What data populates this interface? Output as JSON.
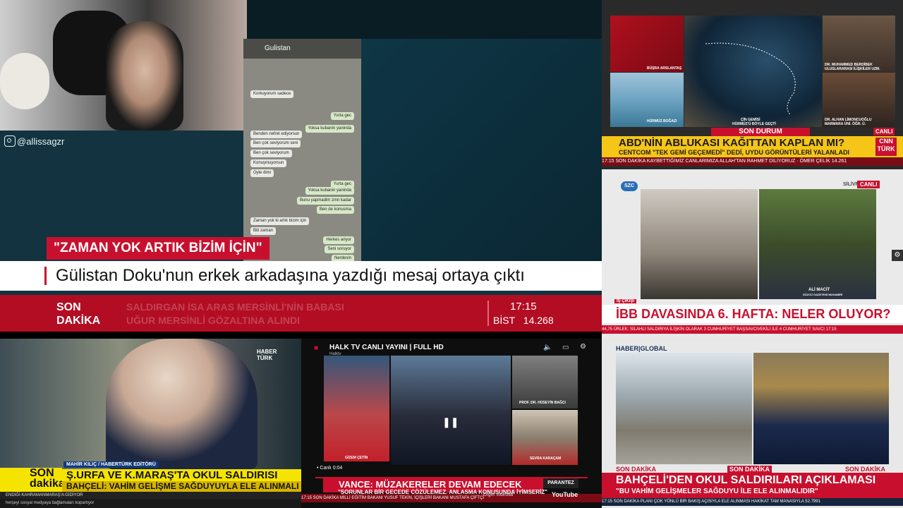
{
  "main": {
    "handle": "@allissagzr",
    "chat_name": "Gulistan",
    "chat_bubbles": [
      {
        "text": "Korkuyorum sadece",
        "dir": "in"
      },
      {
        "text": "Yurta gec",
        "dir": "out"
      },
      {
        "text": "Yoksa kubanin yaninda",
        "dir": "out"
      },
      {
        "text": "Benden nefret ediyorsun",
        "dir": "in"
      },
      {
        "text": "Ben çok seviyorum seni",
        "dir": "in"
      },
      {
        "text": "Ben çok seviyorum",
        "dir": "in"
      },
      {
        "text": "Konuşmuyorsun",
        "dir": "in"
      },
      {
        "text": "Oyle dimi",
        "dir": "in"
      },
      {
        "text": "Yurta gec",
        "dir": "out"
      },
      {
        "text": "Yoksa kubanin yaninda",
        "dir": "out"
      },
      {
        "text": "Bunu yapmadim zmn kadar",
        "dir": "out"
      },
      {
        "text": "Ben de konusma",
        "dir": "out"
      },
      {
        "text": "Zaman yok ki artık bizim için",
        "dir": "in"
      },
      {
        "text": "Biti zaman",
        "dir": "in"
      },
      {
        "text": "Herkes ariyor",
        "dir": "out"
      },
      {
        "text": "Seni soruyor",
        "dir": "out"
      },
      {
        "text": "Nerdesin",
        "dir": "out"
      }
    ],
    "quote": "\"ZAMAN YOK ARTIK BİZİM İÇİN\"",
    "headline": "Gülistan Doku'nun erkek arkadaşına yazdığı mesaj ortaya çıktı",
    "ticker": {
      "son_line1": "SON",
      "son_line2": "DAKİKA",
      "news_line1": "SALDIRGAN İSA ARAS MERSİNLİ'NİN BABASI",
      "news_line2": "UĞUR MERSİNLİ GÖZALTINA ALINDI",
      "time": "17:15",
      "bist_label": "BİST",
      "bist_value": "14.268"
    }
  },
  "cnn": {
    "anchor": "BÜŞRA ARSLANTAŞ",
    "strait": "HÜRMÜZ BOĞAZI",
    "map_caption1": "ÇİN GEMİSİ",
    "map_caption2": "HÜRMÜZ'Ü BÖYLE GEÇTİ",
    "guest1_name": "DR. MUHAMMED BERDİBEK",
    "guest1_title": "ULUSLARARASI İLİŞKİLER UZM.",
    "guest2_name": "DR. ALHAN LİMONCUOĞLU",
    "guest2_title": "MARMARA ÜNİ. ÖĞR. Ü.",
    "son_durum": "SON DURUM",
    "canli": "CANLI",
    "headline": "ABD'NİN ABLUKASI KAĞITTAN KAPLAN MI?",
    "subline": "CENTCOM \"TEK GEMİ GEÇEMEDİ\" DEDİ, UYDU GÖRÜNTÜLERİ YALANLADI",
    "logo1": "CNN",
    "logo2": "TÜRK",
    "ticker": "17:15  SON DAKİKA  KAYBETTİĞİMİZ CANLARIMIZA ALLAH'TAN RAHMET DİLİYORUZ · ÖMER ÇELİK  14.261"
  },
  "szc": {
    "logo": "SZC",
    "location": "SİLİVRİ",
    "canli": "CANLI",
    "reporter_name": "ALİ MACİT",
    "reporter_title": "SÖZCÜ GAZETESİ MUHABİRİ",
    "tag": "İŞ ÇIKIŞI",
    "headline": "İBB DAVASINDA 6. HAFTA: NELER OLUYOR?",
    "ticker": "44,75  ÜRLEK: SİLAHLI SALDIRIYA İLİŞKİN OLARAK 3 CUMHURİYET BAŞSAVCIVEKİLİ İLE 4 CUMHURİYET SAVCI 17:15"
  },
  "haberturk": {
    "logo1": "HABER",
    "logo2": "TÜRK",
    "name": "MAHİR KILIÇ / HABERTÜRK EDİTÖRÜ",
    "son": "SON",
    "dakika": "dakika",
    "headline": "Ş.URFA VE K.MARAŞ'TA OKUL SALDIRISI",
    "subline": "BAHÇELİ: VAHİM GELİŞME SAĞDUYUYLA ELE ALINMALI",
    "ticker1": "ENDİĞİ KAHRAMANMARAŞ'A GİDİYOR",
    "ticker2": "herşeyi sosyal medyaya bağlamaları kopartıyor"
  },
  "halk": {
    "title": "HALK TV CANLI YAYINI | FULL HD",
    "channel": "Halktv",
    "guest1": "PROF. DR. HÜSEYİN BAĞCI",
    "guest2": "SEVRA KARAÇAM",
    "anchor": "GİZEM ÇETİN",
    "canli": "• Canlı",
    "time": "0:04",
    "headline": "VANCE: MÜZAKERELER DEVAM EDECEK",
    "subline": "\"SORUNLAR BİR GECEDE ÇÖZÜLEMEZ, ANLAŞMA KONUSUNDA İYİMSERİZ\"",
    "parantez": "PARANTEZ",
    "other_videos": "Diğer videolar",
    "youtube": "YouTube",
    "ticker": "17:15  SON DAKİKA  MİLLİ EĞİTİM BAKANI YUSUF TEKİN, İÇİŞLERİ BAKANI MUSTAFA ÇİFTÇİ"
  },
  "haberglobal": {
    "logo": "HABER|GLOBAL",
    "son1": "SON DAKİKA",
    "son2": "SON DAKİKA",
    "son3": "SON DAKİKA",
    "headline": "BAHÇELİ'DEN OKUL SALDIRILARI AÇIKLAMASI",
    "subline": "\"BU VAHİM GELİŞMELER SAĞDUYU İLE ELE ALINMALIDIR\"",
    "ticker": "17:15  SON DAKİKA  PLANI ÇOK YÖNLÜ BİR BAKIŞ AÇISIYLA ELE ALINMASI HAKİKAT TAM MANASIYLA  52.7991"
  }
}
